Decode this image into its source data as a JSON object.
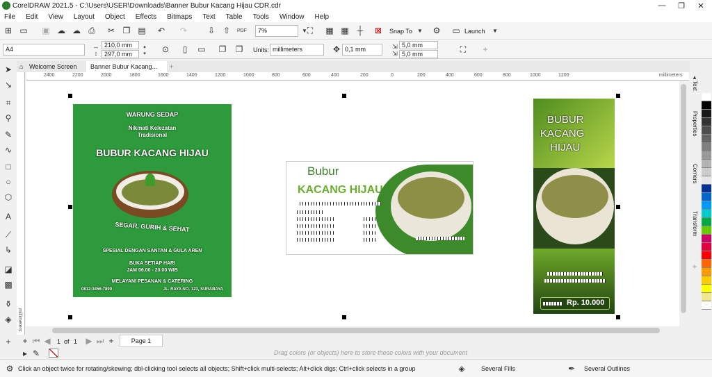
{
  "window": {
    "title": "CorelDRAW 2021.5 - C:\\Users\\USER\\Downloads\\Banner Bubur Kacang Hijau CDR.cdr",
    "minimize": "—",
    "restore": "❐",
    "close": "✕"
  },
  "menu": [
    "File",
    "Edit",
    "View",
    "Layout",
    "Object",
    "Effects",
    "Bitmaps",
    "Text",
    "Table",
    "Tools",
    "Window",
    "Help"
  ],
  "toolbar": {
    "zoom": "7%",
    "snap_label": "Snap To",
    "launch_label": "Launch"
  },
  "propbar": {
    "page_size": "A4",
    "width": "210,0 mm",
    "height": "297,0 mm",
    "units_label": "Units:",
    "units_value": "millimeters",
    "nudge": "0,1 mm",
    "dup_x": "5,0 mm",
    "dup_y": "5,0 mm"
  },
  "tabs": {
    "welcome": "Welcome Screen",
    "doc": "Banner Bubur Kacang...",
    "add": "+"
  },
  "ruler": {
    "h_ticks": [
      "2400",
      "2200",
      "2000",
      "1800",
      "1600",
      "1400",
      "1200",
      "1000",
      "800",
      "600",
      "400",
      "200",
      "0",
      "200",
      "400",
      "600",
      "800",
      "1000",
      "1200"
    ],
    "units": "millimeters",
    "v_units": "millimeters"
  },
  "pages": {
    "counter": "1",
    "of": "of",
    "total": "1",
    "page_tab": "Page 1"
  },
  "palette_hint": "Drag colors (or objects) here to store these colors with your document",
  "status": {
    "hint": "Click an object twice for rotating/skewing; dbl-clicking tool selects all objects; Shift+click multi-selects; Alt+click digs; Ctrl+click selects in a group",
    "fills": "Several Fills",
    "outlines": "Several Outlines"
  },
  "docker_tabs": [
    "Text",
    "Properties",
    "Corners",
    "Transform"
  ],
  "palette_colors": [
    "#ffffff",
    "#000000",
    "#1a1a1a",
    "#333333",
    "#4d4d4d",
    "#666666",
    "#808080",
    "#999999",
    "#b3b3b3",
    "#cccccc",
    "#e6e6e6",
    "#003399",
    "#0066cc",
    "#0099ff",
    "#00cccc",
    "#00aa44",
    "#66cc00",
    "#cc0066",
    "#e4003a",
    "#ff0000",
    "#ff6600",
    "#ff9900",
    "#ffcc00",
    "#ffff00",
    "#f0e68c",
    "#ffffff"
  ],
  "design1": {
    "bg": "#2d9b3b",
    "line1": "WARUNG SEDAP",
    "line2": "Nikmati Kelezatan",
    "line3": "Tradisional",
    "title": "BUBUR KACANG HIJAU",
    "tagline": "SEGAR, GURIH & SEHAT",
    "special": "SPESIAL DENGAN SANTAN & GULA AREN",
    "open": "BUKA SETIAP HARI",
    "hours": "JAM 06.00 - 20.00 WIB",
    "catering": "MELAYANI PESANAN & CATERING",
    "contact": "0812-3456-7890",
    "address": "JL. RAYA NO. 123, SURABAYA"
  },
  "design2": {
    "word1": "Bubur",
    "word2": "KACANG HIJAU"
  },
  "design3": {
    "title1": "BUBUR",
    "title2": "KACANG",
    "title3": "HIJAU",
    "price": "Rp. 10.000"
  }
}
